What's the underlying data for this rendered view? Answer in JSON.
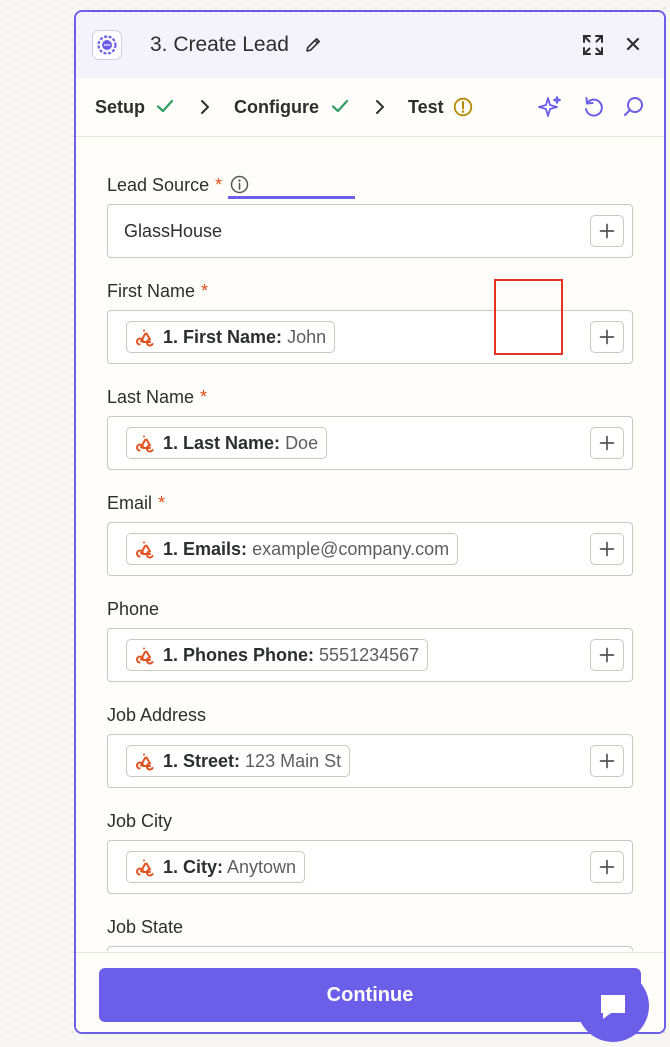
{
  "header": {
    "title": "3. Create Lead"
  },
  "tabs": [
    {
      "label": "Setup",
      "status": "complete"
    },
    {
      "label": "Configure",
      "status": "complete",
      "active": true
    },
    {
      "label": "Test",
      "status": "warning"
    }
  ],
  "fields": [
    {
      "label": "Lead Source",
      "required": "*",
      "value": "GlassHouse"
    },
    {
      "label": "First Name",
      "required": "*",
      "pill_key": "1. First Name:",
      "pill_value": "John"
    },
    {
      "label": "Last Name",
      "required": "*",
      "pill_key": "1. Last Name:",
      "pill_value": "Doe"
    },
    {
      "label": "Email",
      "required": "*",
      "pill_key": "1. Emails:",
      "pill_value": "example@company.com"
    },
    {
      "label": "Phone",
      "pill_key": "1. Phones Phone:",
      "pill_value": "5551234567"
    },
    {
      "label": "Job Address",
      "pill_key": "1. Street:",
      "pill_value": "123 Main St"
    },
    {
      "label": "Job City",
      "pill_key": "1. City:",
      "pill_value": "Anytown"
    },
    {
      "label": "Job State"
    }
  ],
  "footer": {
    "continue_label": "Continue"
  },
  "colors": {
    "accent": "#6b5ee8",
    "required": "#e04f1a",
    "success": "#2f9d62",
    "warning": "#b58a00",
    "pill_icon": "#e0521f",
    "highlight": "#e53222"
  }
}
